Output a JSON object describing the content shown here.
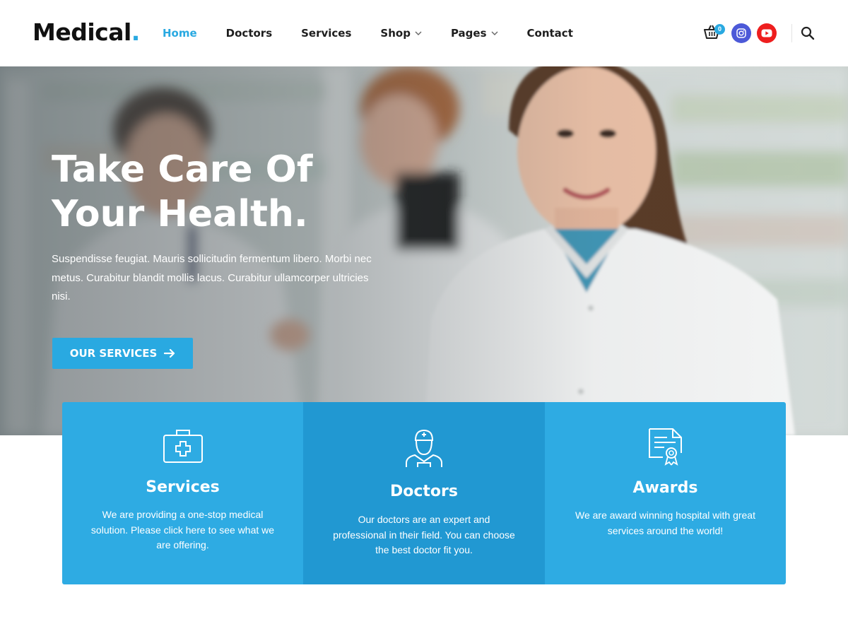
{
  "brand": {
    "name": "Medical",
    "dot": ".",
    "accent": "#29a9e1"
  },
  "nav": {
    "items": [
      {
        "label": "Home",
        "active": true
      },
      {
        "label": "Doctors"
      },
      {
        "label": "Services"
      },
      {
        "label": "Shop",
        "dropdown": true
      },
      {
        "label": "Pages",
        "dropdown": true
      },
      {
        "label": "Contact"
      }
    ]
  },
  "header_icons": {
    "cart_icon": "cart-icon",
    "cart_count": "0",
    "social": [
      "instagram-icon",
      "youtube-icon"
    ],
    "search_icon": "search-icon"
  },
  "hero": {
    "title_line1": "Take Care Of",
    "title_line2": "Your Health.",
    "text": "Suspendisse feugiat. Mauris sollicitudin fermentum libero. Morbi nec metus. Curabitur blandit mollis lacus. Curabitur ullamcorper ultricies nisi.",
    "button_label": "OUR SERVICES"
  },
  "features": [
    {
      "icon": "first-aid-kit-icon",
      "title": "Services",
      "text": "We are providing a one-stop medical solution. Please click here to see what we are offering."
    },
    {
      "icon": "doctor-icon",
      "title": "Doctors",
      "text": "Our doctors are an expert and professional in their field. You can choose the best doctor fit you."
    },
    {
      "icon": "certificate-icon",
      "title": "Awards",
      "text": "We are award winning hospital with great services around the world!"
    }
  ],
  "colors": {
    "card": "#2eabe3",
    "card_mid": "#2198d2",
    "youtube": "#ee1e1e",
    "instagram": "#4c59d8"
  }
}
